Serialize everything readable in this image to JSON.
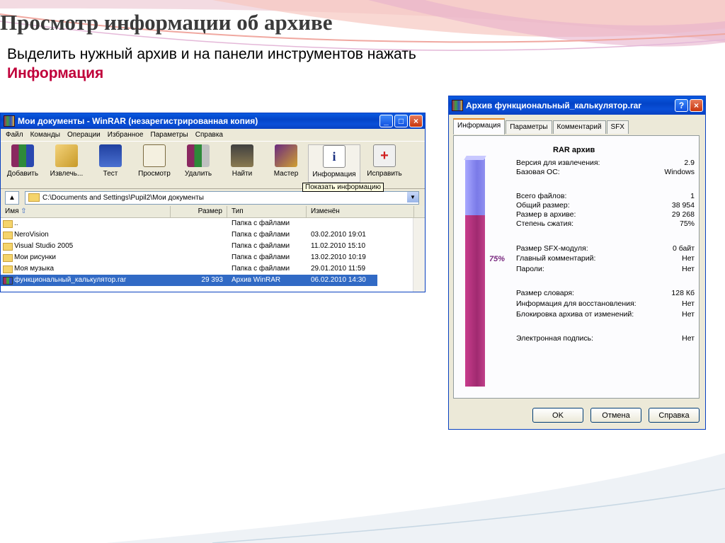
{
  "slide": {
    "title": "Просмотр информации об архиве",
    "subtitle_line1": "Выделить  нужный архив и на панели инструментов нажать",
    "subtitle_highlight": "Информация"
  },
  "winrar": {
    "window_title": "Мои документы - WinRAR (незарегистрированная копия)",
    "menu": [
      "Файл",
      "Команды",
      "Операции",
      "Избранное",
      "Параметры",
      "Справка"
    ],
    "toolbar": [
      {
        "label": "Добавить",
        "icon": "add-archive-icon"
      },
      {
        "label": "Извлечь...",
        "icon": "extract-icon"
      },
      {
        "label": "Тест",
        "icon": "test-icon"
      },
      {
        "label": "Просмотр",
        "icon": "view-icon"
      },
      {
        "label": "Удалить",
        "icon": "delete-icon"
      },
      {
        "label": "Найти",
        "icon": "find-icon"
      },
      {
        "label": "Мастер",
        "icon": "wizard-icon"
      },
      {
        "label": "Информация",
        "icon": "info-icon"
      },
      {
        "label": "Исправить",
        "icon": "repair-icon"
      }
    ],
    "tooltip": "Показать информацию",
    "address": "C:\\Documents and Settings\\Pupil2\\Мои документы",
    "columns": [
      "Имя",
      "Размер",
      "Тип",
      "Изменён"
    ],
    "rows": [
      {
        "name": "..",
        "size": "",
        "type": "Папка с файлами",
        "modified": ""
      },
      {
        "name": "NeroVision",
        "size": "",
        "type": "Папка с файлами",
        "modified": "03.02.2010 19:01"
      },
      {
        "name": "Visual Studio 2005",
        "size": "",
        "type": "Папка с файлами",
        "modified": "11.02.2010 15:10"
      },
      {
        "name": "Мои рисунки",
        "size": "",
        "type": "Папка с файлами",
        "modified": "13.02.2010 10:19"
      },
      {
        "name": "Моя музыка",
        "size": "",
        "type": "Папка с файлами",
        "modified": "29.01.2010 11:59"
      },
      {
        "name": "функциональный_калькулятор.rar",
        "size": "29 393",
        "type": "Архив WinRAR",
        "modified": "06.02.2010 14:30"
      }
    ]
  },
  "dialog": {
    "title": "Архив функциональный_калькулятор.rar",
    "tabs": [
      "Информация",
      "Параметры",
      "Комментарий",
      "SFX"
    ],
    "ratio_label": "75%",
    "ratio_value": 75,
    "heading": "RAR архив",
    "info": [
      {
        "k": "Версия для извлечения:",
        "v": "2.9"
      },
      {
        "k": "Базовая ОС:",
        "v": "Windows"
      },
      {
        "k": "Всего файлов:",
        "v": "1"
      },
      {
        "k": "Общий размер:",
        "v": "38 954"
      },
      {
        "k": "Размер в архиве:",
        "v": "29 268"
      },
      {
        "k": "Степень сжатия:",
        "v": "75%"
      },
      {
        "k": "Размер SFX-модуля:",
        "v": "0 байт"
      },
      {
        "k": "Главный комментарий:",
        "v": "Нет"
      },
      {
        "k": "Пароли:",
        "v": "Нет"
      },
      {
        "k": "Размер словаря:",
        "v": "128 Кб"
      },
      {
        "k": "Информация для восстановления:",
        "v": "Нет"
      },
      {
        "k": "Блокировка архива от изменений:",
        "v": "Нет"
      },
      {
        "k": "Электронная подпись:",
        "v": "Нет"
      }
    ],
    "buttons": {
      "ok": "OK",
      "cancel": "Отмена",
      "help": "Справка"
    }
  }
}
